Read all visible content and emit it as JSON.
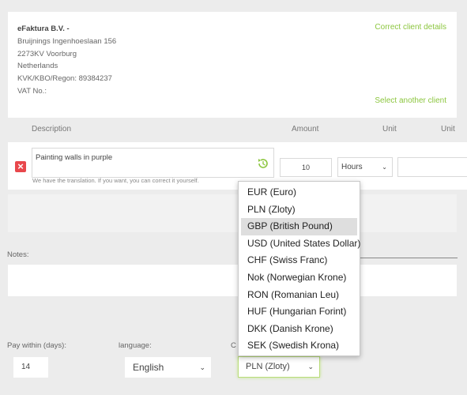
{
  "client": {
    "name": "eFaktura B.V. -",
    "lines": [
      "Bruijnings Ingenhoeslaan 156",
      "2273KV Voorburg",
      "Netherlands",
      "KVK/KBO/Regon: 89384237",
      "VAT No.:"
    ],
    "correct_link": "Correct client details",
    "select_link": "Select another client"
  },
  "columns": {
    "description": "Description",
    "amount": "Amount",
    "unit": "Unit",
    "unit_price": "Unit"
  },
  "item": {
    "description": "Painting walls in purple",
    "hint": "We have the translation. If you want, you can correct it yourself.",
    "amount": "10",
    "unit": "Hours"
  },
  "notes": {
    "label": "Notes:"
  },
  "footer": {
    "pay_label": "Pay within (days):",
    "pay_value": "14",
    "language_label": "language:",
    "language_value": "English",
    "currency_label_partial": "C",
    "currency_value": "PLN (Zloty)"
  },
  "currency_dropdown": {
    "options": [
      "EUR (Euro)",
      "PLN (Zloty)",
      "GBP (British Pound)",
      "USD (United States Dollar)",
      "CHF (Swiss Franc)",
      "Nok (Norwegian Krone)",
      "RON (Romanian Leu)",
      "HUF (Hungarian Forint)",
      "DKK (Danish Krone)",
      "SEK (Swedish Krona)"
    ],
    "highlighted": "GBP (British Pound)"
  },
  "colors": {
    "accent": "#8cc63f",
    "delete": "#e8474c",
    "background": "#ececec"
  }
}
